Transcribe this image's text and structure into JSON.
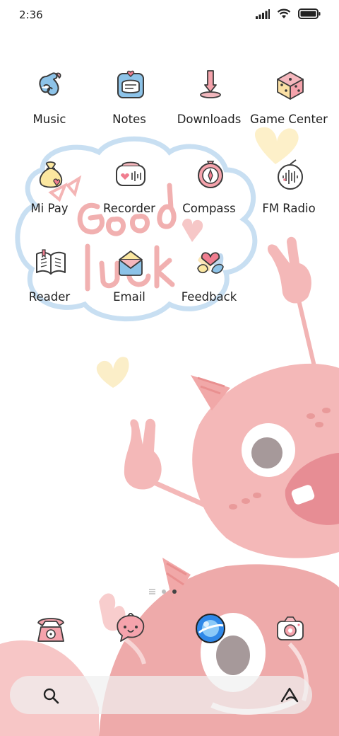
{
  "status_bar": {
    "time": "2:36",
    "icons": [
      "signal-icon",
      "wifi-icon",
      "battery-icon"
    ]
  },
  "wallpaper": {
    "text": "Good luck"
  },
  "apps": [
    {
      "label": "Music",
      "icon": "music-icon"
    },
    {
      "label": "Notes",
      "icon": "notes-icon"
    },
    {
      "label": "Downloads",
      "icon": "downloads-icon"
    },
    {
      "label": "Game Center",
      "icon": "dice-icon"
    },
    {
      "label": "Mi Pay",
      "icon": "money-bag-icon"
    },
    {
      "label": "Recorder",
      "icon": "recorder-icon"
    },
    {
      "label": "Compass",
      "icon": "compass-icon"
    },
    {
      "label": "FM Radio",
      "icon": "radio-icon"
    },
    {
      "label": "Reader",
      "icon": "book-icon"
    },
    {
      "label": "Email",
      "icon": "envelope-icon"
    },
    {
      "label": "Feedback",
      "icon": "feedback-icon"
    }
  ],
  "page_indicator": {
    "pages": 3,
    "current": 3
  },
  "dock": [
    {
      "icon": "phone-icon"
    },
    {
      "icon": "messages-icon"
    },
    {
      "icon": "browser-icon"
    },
    {
      "icon": "camera-icon"
    }
  ],
  "search_bar": {
    "icons": [
      "search-icon",
      "assistant-icon"
    ]
  },
  "colors": {
    "pink": "#f2b3b3",
    "pink_dark": "#e88f96",
    "blue_outline": "#c5ddf0",
    "yellow": "#fbeec8",
    "text": "#222222"
  }
}
